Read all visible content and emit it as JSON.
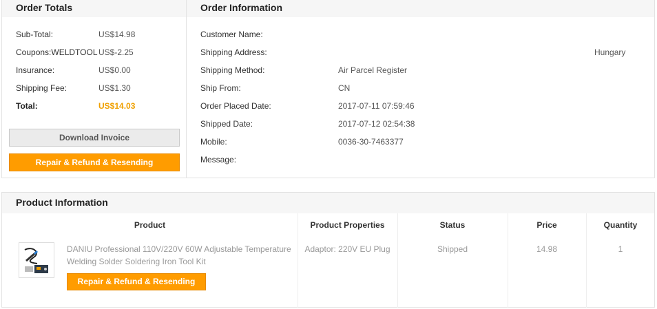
{
  "order_totals": {
    "title": "Order Totals",
    "rows": [
      {
        "label": "Sub-Total:",
        "value": "US$14.98"
      },
      {
        "label": "Coupons:WELDTOOL",
        "value": "US$-2.25"
      },
      {
        "label": "Insurance:",
        "value": "US$0.00"
      },
      {
        "label": "Shipping Fee:",
        "value": "US$1.30"
      }
    ],
    "total_label": "Total:",
    "total_value": "US$14.03",
    "download_invoice": "Download Invoice",
    "repair_refund": "Repair & Refund & Resending"
  },
  "order_info": {
    "title": "Order Information",
    "rows": [
      {
        "label": "Customer Name:",
        "value": ""
      },
      {
        "label": "Shipping Address:",
        "value": "Hungary"
      },
      {
        "label": "Shipping Method:",
        "value": "Air Parcel Register"
      },
      {
        "label": "Ship From:",
        "value": "CN"
      },
      {
        "label": "Order Placed Date:",
        "value": "2017-07-11 07:59:46"
      },
      {
        "label": "Shipped Date:",
        "value": "2017-07-12 02:54:38"
      },
      {
        "label": "Mobile:",
        "value": "0036-30-7463377"
      },
      {
        "label": "Message:",
        "value": ""
      }
    ]
  },
  "product_info": {
    "title": "Product Information",
    "columns": [
      "Product",
      "Product Properties",
      "Status",
      "Price",
      "Quantity"
    ],
    "items": [
      {
        "name": "DANIU Professional 110V/220V 60W Adjustable Temperature Welding Solder Soldering Iron Tool Kit",
        "properties": "Adaptor: 220V EU Plug",
        "status": "Shipped",
        "price": "14.98",
        "quantity": "1",
        "button": "Repair & Refund & Resending"
      }
    ]
  }
}
